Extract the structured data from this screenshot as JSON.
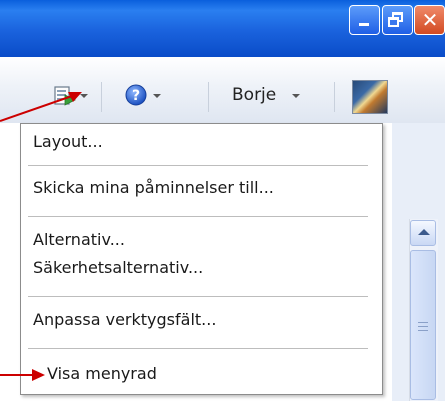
{
  "titlebar": {
    "minimize_icon": "minimize-icon",
    "restore_icon": "restore-icon",
    "close_icon": "close-icon",
    "close_glyph": "✕"
  },
  "toolbar": {
    "tools_icon": "tools-icon",
    "help_icon": "help-icon",
    "user_label": "Borje",
    "photo_icon": "user-photo-icon"
  },
  "menu": {
    "items": [
      "Layout...",
      "Skicka mina påminnelser till...",
      "Alternativ...",
      "Säkerhetsalternativ...",
      "Anpassa verktygsfält...",
      "Visa menyrad"
    ]
  },
  "colors": {
    "titlebar": "#1a62dd",
    "close_button": "#d24a22",
    "annotation_arrow": "#cc0000"
  }
}
